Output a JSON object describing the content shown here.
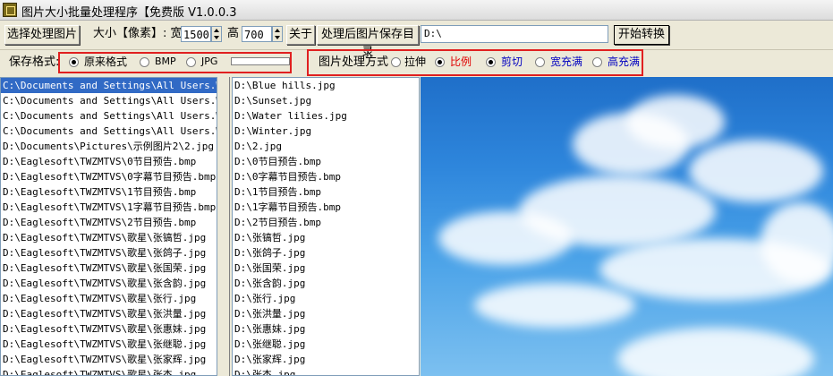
{
  "window": {
    "title": "图片大小批量处理程序【免费版 V1.0.0.3"
  },
  "toolbar": {
    "select_images": "选择处理图片",
    "size_label": "大小【像素】: 宽",
    "width": "1500",
    "height_label": "高",
    "height": "700",
    "about": "关于",
    "save_dir_button": "处理后图片保存目录",
    "save_dir": "D:\\",
    "start": "开始转换"
  },
  "options": {
    "save_format_label": "保存格式:",
    "formats": [
      "原来格式",
      "BMP",
      "JPG"
    ],
    "selected_format": "原来格式",
    "method_label": "图片处理方式",
    "methods": [
      "拉伸",
      "比例",
      "剪切",
      "宽充满",
      "高充满"
    ],
    "selected_methods": [
      "比例",
      "剪切"
    ],
    "colors": {
      "ratio": "#e00000",
      "crop_group": "#0000c0",
      "highlight": "#e02020"
    }
  },
  "source_list": [
    "C:\\Documents and Settings\\All Users.WINDO",
    "C:\\Documents and Settings\\All Users.WINDO",
    "C:\\Documents and Settings\\All Users.WINDO",
    "C:\\Documents and Settings\\All Users.WINDO",
    "D:\\Documents\\Pictures\\示例图片2\\2.jpg",
    "D:\\Eaglesoft\\TWZMTVS\\0节目预告.bmp",
    "D:\\Eaglesoft\\TWZMTVS\\0字幕节目预告.bmp",
    "D:\\Eaglesoft\\TWZMTVS\\1节目预告.bmp",
    "D:\\Eaglesoft\\TWZMTVS\\1字幕节目预告.bmp",
    "D:\\Eaglesoft\\TWZMTVS\\2节目预告.bmp",
    "D:\\Eaglesoft\\TWZMTVS\\歌星\\张镐哲.jpg",
    "D:\\Eaglesoft\\TWZMTVS\\歌星\\张鸽子.jpg",
    "D:\\Eaglesoft\\TWZMTVS\\歌星\\张国荣.jpg",
    "D:\\Eaglesoft\\TWZMTVS\\歌星\\张含韵.jpg",
    "D:\\Eaglesoft\\TWZMTVS\\歌星\\张行.jpg",
    "D:\\Eaglesoft\\TWZMTVS\\歌星\\张洪量.jpg",
    "D:\\Eaglesoft\\TWZMTVS\\歌星\\张惠妹.jpg",
    "D:\\Eaglesoft\\TWZMTVS\\歌星\\张继聪.jpg",
    "D:\\Eaglesoft\\TWZMTVS\\歌星\\张家辉.jpg",
    "D:\\Eaglesoft\\TWZMTVS\\歌星\\张杰.jpg"
  ],
  "output_list": [
    "D:\\Blue hills.jpg",
    "D:\\Sunset.jpg",
    "D:\\Water lilies.jpg",
    "D:\\Winter.jpg",
    "D:\\2.jpg",
    "D:\\0节目预告.bmp",
    "D:\\0字幕节目预告.bmp",
    "D:\\1节目预告.bmp",
    "D:\\1字幕节目预告.bmp",
    "D:\\2节目预告.bmp",
    "D:\\张镐哲.jpg",
    "D:\\张鸽子.jpg",
    "D:\\张国荣.jpg",
    "D:\\张含韵.jpg",
    "D:\\张行.jpg",
    "D:\\张洪量.jpg",
    "D:\\张惠妹.jpg",
    "D:\\张继聪.jpg",
    "D:\\张家辉.jpg",
    "D:\\张杰.jpg"
  ],
  "preview": {
    "image": "sky-clouds-image"
  }
}
